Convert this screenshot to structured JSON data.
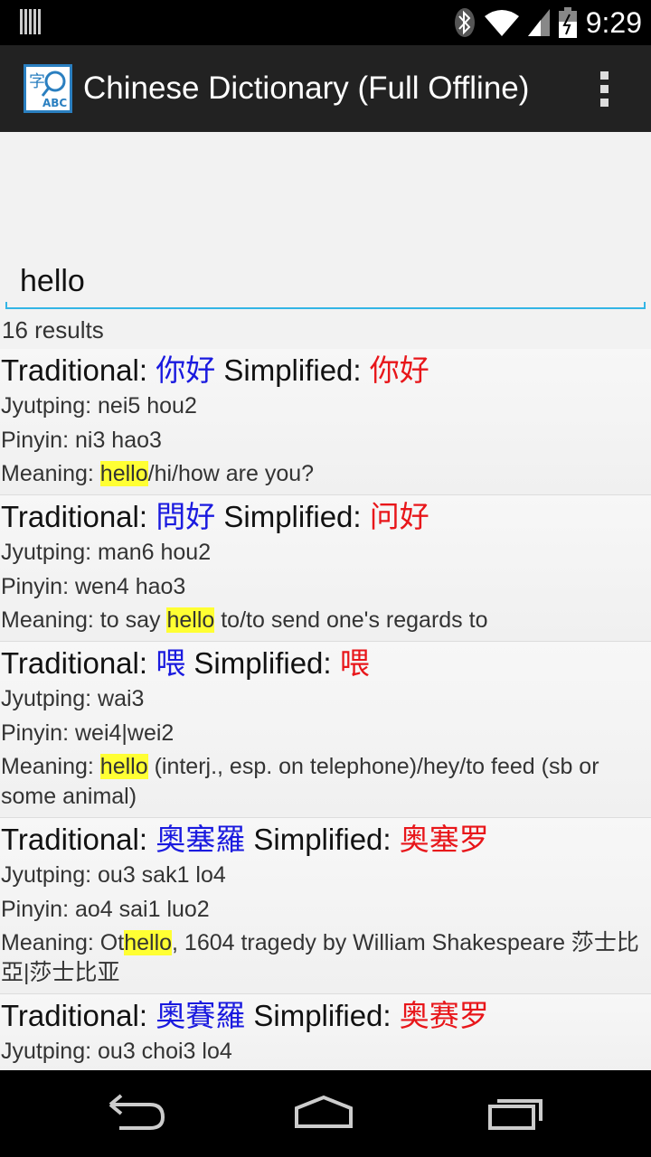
{
  "status_bar": {
    "time": "9:29",
    "icons": [
      "barcode-icon",
      "bluetooth-icon",
      "wifi-icon",
      "signal-icon",
      "battery-icon"
    ]
  },
  "action_bar": {
    "title": "Chinese Dictionary (Full Offline)",
    "icon": "dictionary-app-icon",
    "overflow_icon": "overflow-menu-icon"
  },
  "search": {
    "value": "hello",
    "placeholder": ""
  },
  "results_count": "16 results",
  "labels": {
    "traditional": "Traditional: ",
    "simplified": " Simplified: ",
    "jyutping": "Jyutping: ",
    "pinyin": "Pinyin: ",
    "meaning": "Meaning: "
  },
  "entries": [
    {
      "traditional": "你好",
      "simplified": "你好",
      "jyutping": "nei5 hou2",
      "pinyin": "ni3 hao3",
      "meaning_before": "",
      "meaning_highlight": "hello",
      "meaning_after": "/hi/how are you?"
    },
    {
      "traditional": "問好",
      "simplified": "问好",
      "jyutping": "man6 hou2",
      "pinyin": "wen4 hao3",
      "meaning_before": "to say ",
      "meaning_highlight": "hello",
      "meaning_after": " to/to send one's regards to"
    },
    {
      "traditional": "喂",
      "simplified": "喂",
      "jyutping": "wai3",
      "pinyin": "wei4|wei2",
      "meaning_before": "",
      "meaning_highlight": "hello",
      "meaning_after": " (interj., esp. on telephone)/hey/to feed (sb or some animal)"
    },
    {
      "traditional": "奧塞羅",
      "simplified": "奥塞罗",
      "jyutping": "ou3 sak1 lo4",
      "pinyin": "ao4 sai1 luo2",
      "meaning_before": "Ot",
      "meaning_highlight": "hello",
      "meaning_after": ", 1604 tragedy by William Shakespeare 莎士比亞|莎士比亚"
    },
    {
      "traditional": "奧賽羅",
      "simplified": "奥赛罗",
      "jyutping": "ou3 choi3 lo4",
      "pinyin": "",
      "meaning_before": "",
      "meaning_highlight": "",
      "meaning_after": ""
    }
  ],
  "nav_bar": {
    "icons": [
      "back-icon",
      "home-icon",
      "recents-icon"
    ]
  },
  "colors": {
    "traditional": "#1a1adf",
    "simplified": "#e8161a",
    "highlight": "#ffff33",
    "accent": "#33b5e5"
  }
}
